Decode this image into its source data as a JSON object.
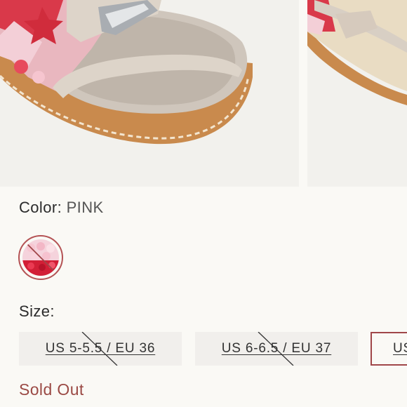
{
  "product": {
    "color_label": "Color:",
    "color_value": "PINK",
    "swatch_name": "pink-swatch-icon",
    "size_label": "Size:",
    "sizes": [
      {
        "label": "US 5-5.5 / EU 36",
        "available": false
      },
      {
        "label": "US 6-6.5 / EU 37",
        "available": false
      },
      {
        "label": "US",
        "available": true,
        "selected": true
      }
    ],
    "status": "Sold Out"
  },
  "colors": {
    "background": "#faf9f5",
    "size_button_bg": "#f1efec",
    "selected_border": "#a04649",
    "sold_out_text": "#9b4a45",
    "swatch_ring": "#b45254"
  }
}
